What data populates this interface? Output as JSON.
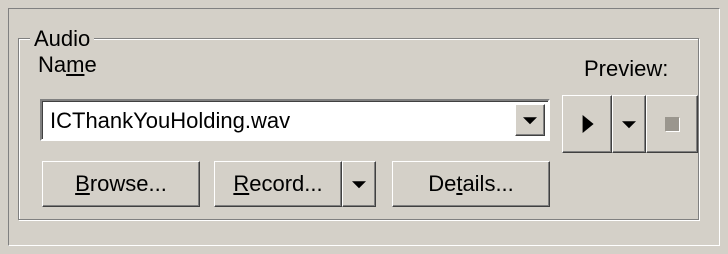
{
  "group": {
    "title": "Audio",
    "name_label_pre": "Na",
    "name_label_mnemonic": "m",
    "name_label_post": "e",
    "preview_label": "Preview:"
  },
  "audio_file": {
    "selected_value": "ICThankYouHolding.wav"
  },
  "buttons": {
    "browse_mnemonic": "B",
    "browse_rest": "rowse...",
    "record_mnemonic": "R",
    "record_rest": "ecord...",
    "details_pre": "De",
    "details_mnemonic": "t",
    "details_post": "ails..."
  },
  "icons": {
    "combo_dropdown": "chevron-down-icon",
    "play": "play-icon",
    "play_dropdown": "chevron-down-icon",
    "stop": "stop-icon",
    "record_dropdown": "chevron-down-icon"
  },
  "colors": {
    "face": "#d4d0c8",
    "field": "#ffffff",
    "shadow": "#808080",
    "disabled_glyph": "#9a968e"
  }
}
